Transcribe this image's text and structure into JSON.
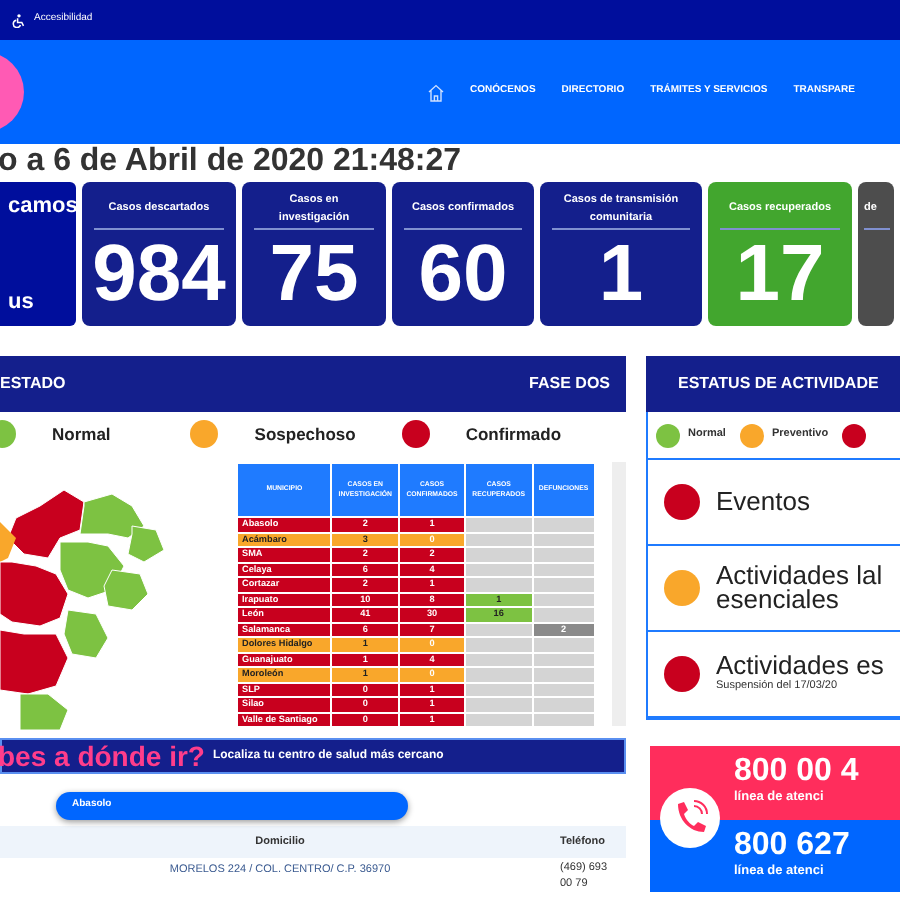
{
  "top_bar": {
    "accessibility_label": "Accesibilidad"
  },
  "nav": {
    "items": [
      "CONÓCENOS",
      "DIRECTORIO",
      "TRÁMITES Y SERVICIOS",
      "TRANSPARE"
    ]
  },
  "update_title": "o a 6 de Abril de 2020 21:48:27",
  "intro": {
    "lines": [
      "camos",
      "us"
    ]
  },
  "stats": [
    {
      "label": "Casos descartados",
      "value": "984",
      "kind": "primary"
    },
    {
      "label": "Casos en investigación",
      "value": "75",
      "kind": "primary"
    },
    {
      "label": "Casos confirmados",
      "value": "60",
      "kind": "primary"
    },
    {
      "label": "Casos de transmisión comunitaria",
      "value": "1",
      "kind": "primary"
    },
    {
      "label": "Casos recuperados",
      "value": "17",
      "kind": "success"
    },
    {
      "label": "de",
      "kind": "dark"
    }
  ],
  "state_panel": {
    "title": "ESTADO",
    "phase": "FASE DOS",
    "legend": [
      {
        "label": "Normal",
        "color": "#7dc242"
      },
      {
        "label": "Sospechoso",
        "color": "#f9a72b"
      },
      {
        "label": "Confirmado",
        "color": "#c8001e"
      }
    ],
    "table": {
      "columns": [
        "MUNICIPIO",
        "CASOS EN INVESTIGACIÓN",
        "CASOS CONFIRMADOS",
        "CASOS RECUPERADOS",
        "DEFUNCIONES"
      ],
      "rows": [
        {
          "cells": [
            "Abasolo",
            "2",
            "1",
            "",
            ""
          ],
          "color": "#c8001e"
        },
        {
          "cells": [
            "Acámbaro",
            "3",
            "0",
            "",
            ""
          ],
          "color": "#f9a72b"
        },
        {
          "cells": [
            "SMA",
            "2",
            "2",
            "",
            ""
          ],
          "color": "#c8001e"
        },
        {
          "cells": [
            "Celaya",
            "6",
            "4",
            "",
            ""
          ],
          "color": "#c8001e"
        },
        {
          "cells": [
            "Cortazar",
            "2",
            "1",
            "",
            ""
          ],
          "color": "#c8001e"
        },
        {
          "cells": [
            "Irapuato",
            "10",
            "8",
            "1",
            ""
          ],
          "color": "#c8001e"
        },
        {
          "cells": [
            "León",
            "41",
            "30",
            "16",
            ""
          ],
          "color": "#c8001e"
        },
        {
          "cells": [
            "Salamanca",
            "6",
            "7",
            "",
            "2"
          ],
          "color": "#c8001e"
        },
        {
          "cells": [
            "Dolores Hidalgo",
            "1",
            "0",
            "",
            ""
          ],
          "color": "#f9a72b"
        },
        {
          "cells": [
            "Guanajuato",
            "1",
            "4",
            "",
            ""
          ],
          "color": "#c8001e"
        },
        {
          "cells": [
            "Moroleón",
            "1",
            "0",
            "",
            ""
          ],
          "color": "#f9a72b"
        },
        {
          "cells": [
            "SLP",
            "0",
            "1",
            "",
            ""
          ],
          "color": "#c8001e"
        },
        {
          "cells": [
            "Silao",
            "0",
            "1",
            "",
            ""
          ],
          "color": "#c8001e"
        },
        {
          "cells": [
            "Valle de Santiago",
            "0",
            "1",
            "",
            ""
          ],
          "color": "#c8001e"
        }
      ]
    }
  },
  "activities_panel": {
    "title": "ESTATUS DE ACTIVIDADE",
    "legend": [
      {
        "label": "Normal",
        "color": "#7dc242"
      },
      {
        "label": "Preventivo",
        "color": "#f9a72b"
      },
      {
        "color": "#c8001e"
      }
    ],
    "items": [
      {
        "title": "Eventos",
        "color": "#c8001e"
      },
      {
        "title": "Actividades lal esenciales",
        "color": "#f9a72b"
      },
      {
        "title": "Actividades es",
        "note": "Suspensión del 17/03/20",
        "color": "#c8001e"
      }
    ]
  },
  "locator": {
    "title": "bes a dónde ir?",
    "subtitle": "Localiza tu centro de salud más cercano",
    "select_value": "Abasolo",
    "columns": [
      "Domicilio",
      "Teléfono"
    ],
    "rows": [
      [
        "MORELOS 224 / COL. CENTRO/ C.P. 36970",
        "(469) 693 00 79"
      ]
    ]
  },
  "hotline": [
    {
      "number": "800 00 4",
      "caption": "línea de atenci"
    },
    {
      "number": "800 627",
      "caption": "línea de atenci"
    }
  ]
}
